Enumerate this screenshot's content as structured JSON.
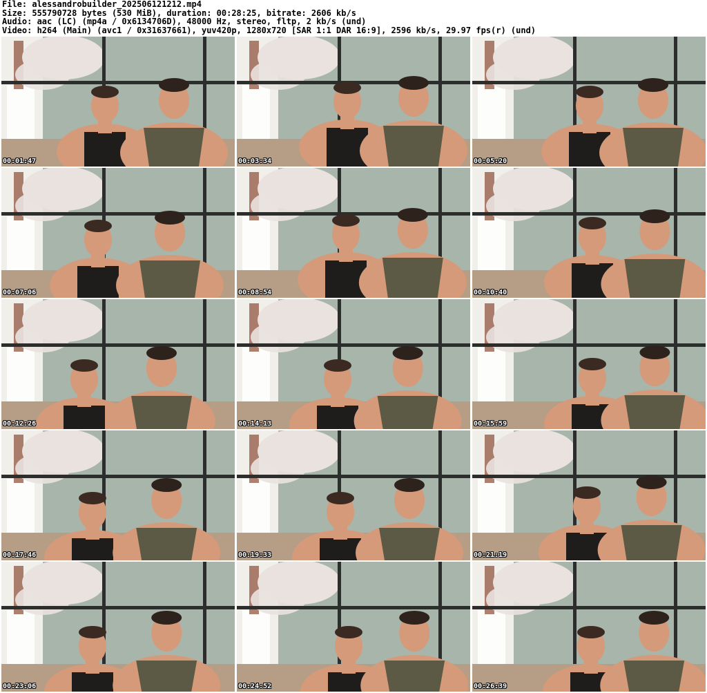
{
  "header": {
    "file": "File: alessandrobuilder_202506121212.mp4",
    "size": "Size: 555790728 bytes (530 MiB), duration: 00:28:25, bitrate: 2606 kb/s",
    "audio": "Audio: aac (LC) (mp4a / 0x6134706D), 48000 Hz, stereo, fltp, 2 kb/s (und)",
    "video": "Video: h264 (Main) (avc1 / 0x31637661), yuv420p, 1280x720 [SAR 1:1 DAR 16:9], 2596 kb/s, 29.97 fps(r) (und)"
  },
  "thumbnails": [
    {
      "timestamp": "00:01:47"
    },
    {
      "timestamp": "00:03:34"
    },
    {
      "timestamp": "00:05:20"
    },
    {
      "timestamp": "00:07:06"
    },
    {
      "timestamp": "00:08:54"
    },
    {
      "timestamp": "00:10:40"
    },
    {
      "timestamp": "00:12:26"
    },
    {
      "timestamp": "00:14:13"
    },
    {
      "timestamp": "00:15:59"
    },
    {
      "timestamp": "00:17:46"
    },
    {
      "timestamp": "00:19:33"
    },
    {
      "timestamp": "00:21:19"
    },
    {
      "timestamp": "00:23:06"
    },
    {
      "timestamp": "00:24:52"
    },
    {
      "timestamp": "00:26:39"
    }
  ],
  "colors": {
    "background": "#ffffff",
    "header_text": "#000000",
    "timestamp_text": "#ffffff",
    "window_frame": "#2b2e2d",
    "wall": "#d9d6cf",
    "blossom": "#e9e2df",
    "mural": "#7f9a8e",
    "sofa": "#b59d86",
    "skin": "#d49a7a",
    "tank_black": "#1f1c1c",
    "tank_olive": "#5c5a44"
  }
}
